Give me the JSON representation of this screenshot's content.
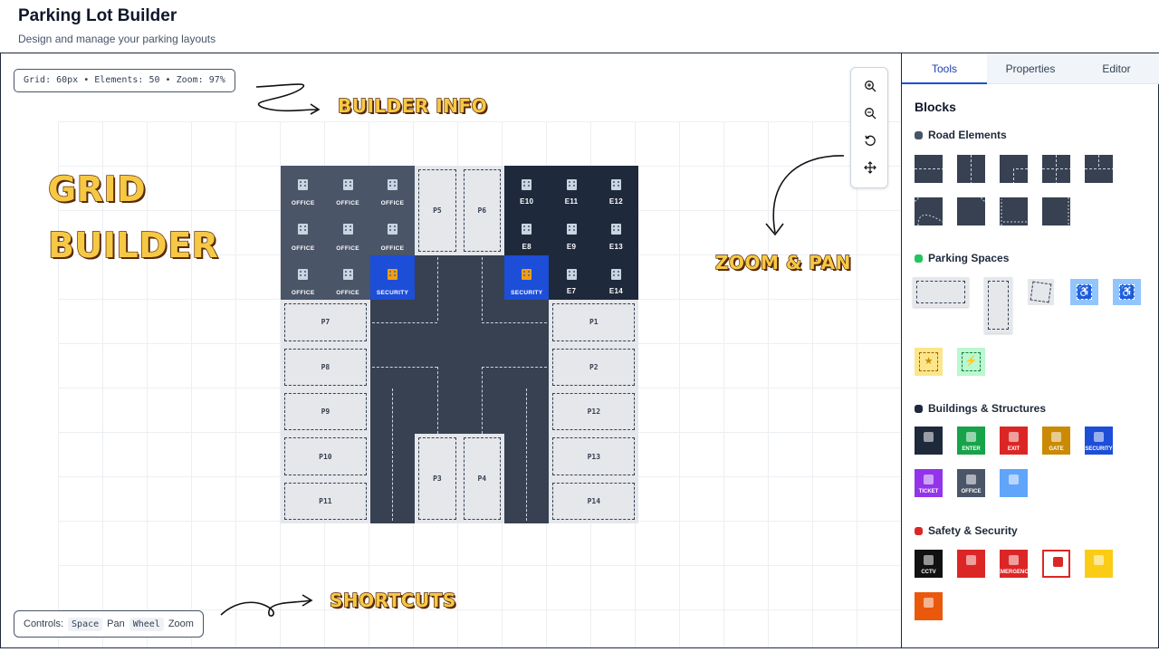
{
  "header": {
    "title": "Parking Lot Builder",
    "subtitle": "Design and manage your parking layouts"
  },
  "canvas": {
    "info": "Grid: 60px • Elements: 50 • Zoom: 97%",
    "controls_label": "Controls:",
    "key_space": "Space",
    "key_space_action": "Pan",
    "key_wheel": "Wheel",
    "key_wheel_action": "Zoom"
  },
  "annotations": {
    "builder_info": "BUILDER INFO",
    "grid": "GRID",
    "builder": "BUILDER",
    "zoom_pan": "ZOOM & PAN",
    "shortcuts": "SHORTCUTS"
  },
  "zoom_controls": [
    "zoom-in-icon",
    "zoom-out-icon",
    "reset-view-icon",
    "pan-icon"
  ],
  "lot": {
    "office_label": "OFFICE",
    "security_label": "SECURITY",
    "employee_buildings": [
      "E10",
      "E11",
      "E12",
      "E8",
      "E9",
      "E13",
      "E7",
      "E14"
    ],
    "spaces_left": [
      "P7",
      "P8",
      "P9",
      "P10",
      "P11"
    ],
    "spaces_right": [
      "P1",
      "P2",
      "P12",
      "P13",
      "P14"
    ],
    "spaces_top": [
      "P5",
      "P6"
    ],
    "spaces_bottom": [
      "P3",
      "P4"
    ]
  },
  "sidebar": {
    "tabs": [
      "Tools",
      "Properties",
      "Editor"
    ],
    "active_tab": "Tools",
    "blocks_title": "Blocks",
    "categories": [
      {
        "name": "Road Elements",
        "color": "#475569"
      },
      {
        "name": "Parking Spaces",
        "color": "#22c55e"
      },
      {
        "name": "Buildings & Structures",
        "color": "#1e293b"
      },
      {
        "name": "Safety & Security",
        "color": "#dc2626"
      }
    ],
    "building_tiles": [
      {
        "label": "",
        "color": "#1e293b",
        "icon": "building-icon"
      },
      {
        "label": "ENTER",
        "color": "#16a34a",
        "icon": "door-icon"
      },
      {
        "label": "EXIT",
        "color": "#dc2626",
        "icon": "door-icon"
      },
      {
        "label": "GATE",
        "color": "#ca8a04",
        "icon": "barrier-icon"
      },
      {
        "label": "SECURITY",
        "color": "#1d4ed8",
        "icon": "guard-house-icon"
      },
      {
        "label": "TICKET",
        "color": "#9333ea",
        "icon": "ticket-icon"
      },
      {
        "label": "OFFICE",
        "color": "#4a5568",
        "icon": "building-icon"
      },
      {
        "label": "",
        "color": "#60a5fa",
        "icon": "restroom-icon"
      }
    ],
    "safety_tiles": [
      {
        "label": "CCTV",
        "color": "#111111",
        "icon": "camera-icon"
      },
      {
        "label": "",
        "color": "#dc2626",
        "icon": "fire-extinguisher-icon"
      },
      {
        "label": "EMERGENCY",
        "color": "#dc2626",
        "icon": "alarm-icon"
      },
      {
        "label": "",
        "color": "#ffffff",
        "icon": "siren-icon"
      },
      {
        "label": "",
        "color": "#facc15",
        "icon": "light-bulb-icon"
      },
      {
        "label": "",
        "color": "#ea580c",
        "icon": "phone-icon"
      }
    ]
  }
}
